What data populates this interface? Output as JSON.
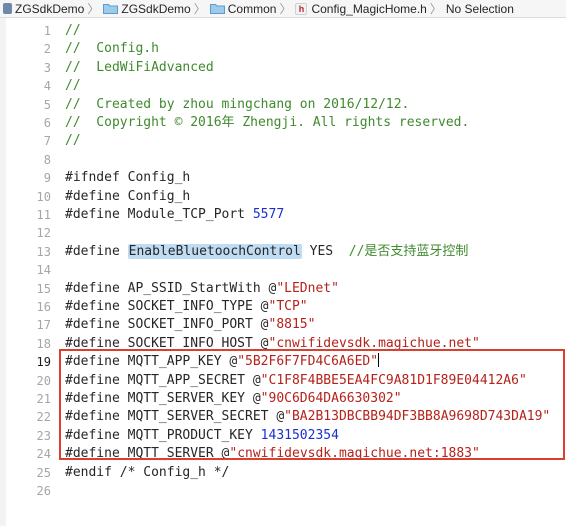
{
  "jumpbar": {
    "crumbs": [
      "ZGSdkDemo",
      "ZGSdkDemo",
      "Common",
      "Config_MagicHome.h",
      "No Selection"
    ]
  },
  "editor": {
    "current_line": 19,
    "lines": [
      {
        "n": "1",
        "segments": [
          {
            "t": "//",
            "c": "cmt"
          }
        ]
      },
      {
        "n": "2",
        "segments": [
          {
            "t": "//  Config.h",
            "c": "cmt"
          }
        ]
      },
      {
        "n": "3",
        "segments": [
          {
            "t": "//  LedWiFiAdvanced",
            "c": "cmt"
          }
        ]
      },
      {
        "n": "4",
        "segments": [
          {
            "t": "//",
            "c": "cmt"
          }
        ]
      },
      {
        "n": "5",
        "segments": [
          {
            "t": "//  Created by zhou mingchang on 2016/12/12.",
            "c": "cmt"
          }
        ]
      },
      {
        "n": "6",
        "segments": [
          {
            "t": "//  Copyright © 2016年 Zhengji. All rights reserved.",
            "c": "cmt"
          }
        ]
      },
      {
        "n": "7",
        "segments": [
          {
            "t": "//",
            "c": "cmt"
          }
        ]
      },
      {
        "n": "8",
        "segments": []
      },
      {
        "n": "9",
        "segments": [
          {
            "t": "#ifndef Config_h",
            "c": ""
          }
        ]
      },
      {
        "n": "10",
        "segments": [
          {
            "t": "#define Config_h",
            "c": ""
          }
        ]
      },
      {
        "n": "11",
        "segments": [
          {
            "t": "#define Module_TCP_Port ",
            "c": ""
          },
          {
            "t": "5577",
            "c": "num"
          }
        ]
      },
      {
        "n": "12",
        "segments": []
      },
      {
        "n": "13",
        "segments": [
          {
            "t": "#define ",
            "c": ""
          },
          {
            "t": "EnableBluetoochControl",
            "c": "hl"
          },
          {
            "t": " YES  ",
            "c": ""
          },
          {
            "t": "//是否支持蓝牙控制",
            "c": "cmt"
          }
        ]
      },
      {
        "n": "14",
        "segments": []
      },
      {
        "n": "15",
        "segments": [
          {
            "t": "#define AP_SSID_StartWith @",
            "c": ""
          },
          {
            "t": "\"LEDnet\"",
            "c": "str"
          }
        ]
      },
      {
        "n": "16",
        "segments": [
          {
            "t": "#define SOCKET_INFO_TYPE @",
            "c": ""
          },
          {
            "t": "\"TCP\"",
            "c": "str"
          }
        ]
      },
      {
        "n": "17",
        "segments": [
          {
            "t": "#define SOCKET_INFO_PORT @",
            "c": ""
          },
          {
            "t": "\"8815\"",
            "c": "str"
          }
        ]
      },
      {
        "n": "18",
        "segments": [
          {
            "t": "#define SOCKET_INFO_HOST @",
            "c": ""
          },
          {
            "t": "\"cnwifidevsdk.magichue.net\"",
            "c": "str"
          }
        ]
      },
      {
        "n": "19",
        "segments": [
          {
            "t": "#define MQTT_APP_KEY @",
            "c": ""
          },
          {
            "t": "\"5B2F6F7FD4C6A6ED\"",
            "c": "str"
          },
          {
            "t": "",
            "c": "caret"
          }
        ]
      },
      {
        "n": "20",
        "segments": [
          {
            "t": "#define MQTT_APP_SECRET @",
            "c": ""
          },
          {
            "t": "\"C1F8F4BBE5EA4FC9A81D1F89E04412A6\"",
            "c": "str"
          }
        ]
      },
      {
        "n": "21",
        "segments": [
          {
            "t": "#define MQTT_SERVER_KEY @",
            "c": ""
          },
          {
            "t": "\"90C6D64DA6630302\"",
            "c": "str"
          }
        ]
      },
      {
        "n": "22",
        "segments": [
          {
            "t": "#define MQTT_SERVER_SECRET @",
            "c": ""
          },
          {
            "t": "\"BA2B13DBCBB94DF3BB8A9698D743DA19\"",
            "c": "str"
          }
        ]
      },
      {
        "n": "23",
        "segments": [
          {
            "t": "#define MQTT_PRODUCT_KEY ",
            "c": ""
          },
          {
            "t": "1431502354",
            "c": "num"
          }
        ]
      },
      {
        "n": "24",
        "segments": [
          {
            "t": "#define MQTT_SERVER @",
            "c": ""
          },
          {
            "t": "\"cnwifidevsdk.magichue.net:1883\"",
            "c": "str"
          }
        ]
      },
      {
        "n": "25",
        "segments": [
          {
            "t": "#endif /* Config_h */",
            "c": ""
          }
        ]
      },
      {
        "n": "26",
        "segments": []
      }
    ]
  },
  "colors": {
    "comment": "#3f8a2e",
    "string": "#b5221c",
    "number": "#1c2fd1",
    "highlight_box": "#d9402f"
  }
}
